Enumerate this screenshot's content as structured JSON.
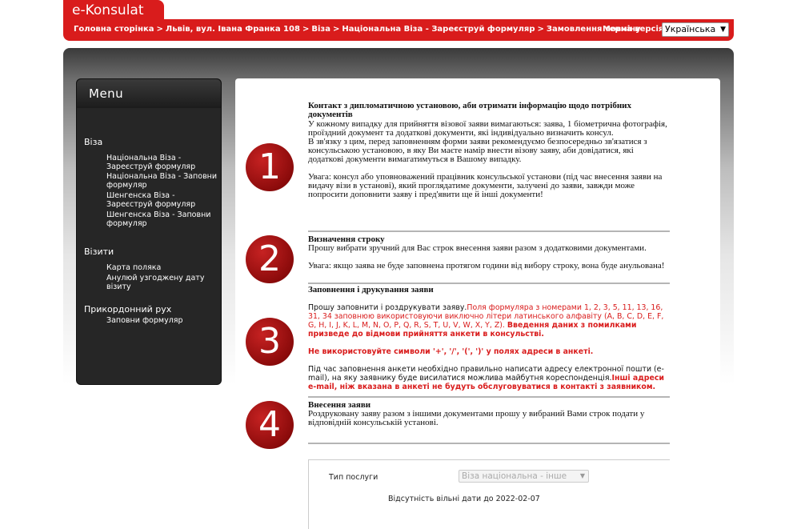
{
  "header": {
    "logo": "e-Konsulat",
    "breadcrumb": [
      "Головна сторінка",
      "Львів, вул. Івана Франка 108",
      "Віза",
      "Національна Віза - Зареєструй формуляр",
      "Замовлення терміну"
    ],
    "breadcrumb_sep": ">",
    "lang_label": "Мовна версія",
    "lang_selected": "Українська"
  },
  "sidebar": {
    "title": "Menu",
    "sections": [
      {
        "title": "Віза",
        "items": [
          "Національна Віза - Зареєструй формуляр",
          "Національна Віза - Заповни формуляр",
          "Шенгенска Віза - Зареєструй формуляр",
          "Шенгенска Віза - Заповни формуляр"
        ]
      },
      {
        "title": "Візити",
        "items": [
          "Карта поляка",
          "Анулюй узгоджену дату візиту"
        ]
      },
      {
        "title": "Прикордонний рух",
        "items": [
          "Заповни формуляр"
        ]
      }
    ]
  },
  "steps": [
    {
      "number": "1",
      "title": "Контакт з дипломатичною установою, аби отримати інформацію щодо потрібних документів",
      "p1": "У кожному випадку для прийняття візової заяви вимагаються: заява, 1 біометрична фотографія, проїздний документ та додаткові документи, які індивідуально визначить консул.",
      "p2": "В зв'язку з цим, перед заповненням форми заяви рекомендуємо безпосередньо зв'язатися з консульською установою, в яку Ви маєте намір внести візову заяву, аби довідатися, які додаткові документи вимагатимуться в Вашому випадку.",
      "p3": "Увага: консул або уповноважений працівник консульської установи (під час внесення заяви на видачу візи в установі), який проглядатиме документи, залучені до заяви, завжди може попросити доповнити заяву і пред'явити ще й інші документи!"
    },
    {
      "number": "2",
      "title": "Визначення строку",
      "p1": "Прошу вибрати зручний для Вас строк внесення заяви разом з додатковими документами.",
      "p2": "Увага: якщо заява не буде заповнена протягом години від вибору строку, вона буде анульована!"
    },
    {
      "number": "3",
      "title": "Заповнення і друкування заяви",
      "p1_plain": "Прошу заповнити і роздрукувати заяву.",
      "p1_red": "Поля формуляра з номерами 1, 2, 3, 5, 11, 13, 16, 31, 34 заповнюю використовуючи виключно літери латинського алфавіту (A, B, C, D, E, F, G, H, I, J, K, L, M, N, O, P, Q, R, S, T, U, V, W, X, Y, Z).",
      "p1_red_bold": "Введення даних з помилками призведе до відмови прийняття анкети в консульстві.",
      "p2_red_bold": "Не використовуйте символи '+', '/', '(', ')' у полях адреси в анкеті.",
      "p3_plain": "Під час заповнення анкети необхідно правильно написати адресу електронної пошти (e-mail), на яку заявнику буде висилатися можлива майбутня кореспонденція.",
      "p3_red_bold": "Інші адреси e-mail, ніж вказана в анкеті не будуть обслуговуватися в контакті з заявником."
    },
    {
      "number": "4",
      "title": "Внесення заяви",
      "p1": "Роздруковану заяву разом з іншими документами прошу у вибраний Вами строк подати у відповідній консульській установі."
    }
  ],
  "service": {
    "label": "Тип послуги",
    "selected": "Віза національна - інше",
    "note": "Відсутність вільні дати до 2022-02-07"
  }
}
